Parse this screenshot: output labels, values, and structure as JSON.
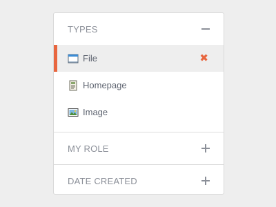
{
  "filters": {
    "types": {
      "title": "TYPES",
      "toggle": "collapse",
      "items": [
        {
          "label": "File",
          "icon": "window-file-icon",
          "selected": true
        },
        {
          "label": "Homepage",
          "icon": "homepage-page-icon",
          "selected": false
        },
        {
          "label": "Image",
          "icon": "picture-icon",
          "selected": false
        }
      ]
    },
    "my_role": {
      "title": "MY ROLE",
      "toggle": "expand"
    },
    "date_created": {
      "title": "DATE CREATED",
      "toggle": "expand"
    }
  },
  "colors": {
    "accent": "#e8663f",
    "text": "#5e6470",
    "muted": "#8b8f98",
    "selected_bg": "#eeeeee"
  }
}
